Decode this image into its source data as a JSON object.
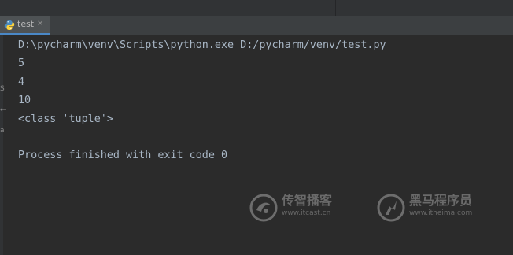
{
  "tab": {
    "label": "test",
    "close_glyph": "✕",
    "icon": "python-icon"
  },
  "console": {
    "lines": [
      "D:\\pycharm\\venv\\Scripts\\python.exe D:/pycharm/venv/test.py",
      "5",
      "4",
      "10",
      "<class 'tuple'>",
      "",
      "Process finished with exit code 0"
    ]
  },
  "gutter": {
    "marks": [
      "S",
      "←",
      "a"
    ]
  },
  "watermarks": [
    {
      "name": "传智播客",
      "trademark": "®",
      "url": "www.itcast.cn",
      "icon": "itcast-logo"
    },
    {
      "name": "黑马程序员",
      "trademark": "®",
      "url": "www.itheima.com",
      "icon": "itheima-logo"
    }
  ],
  "colors": {
    "background": "#2b2b2b",
    "text": "#a9b7c6",
    "tab_active": "#4e5254",
    "tab_underline": "#4a88c7"
  }
}
